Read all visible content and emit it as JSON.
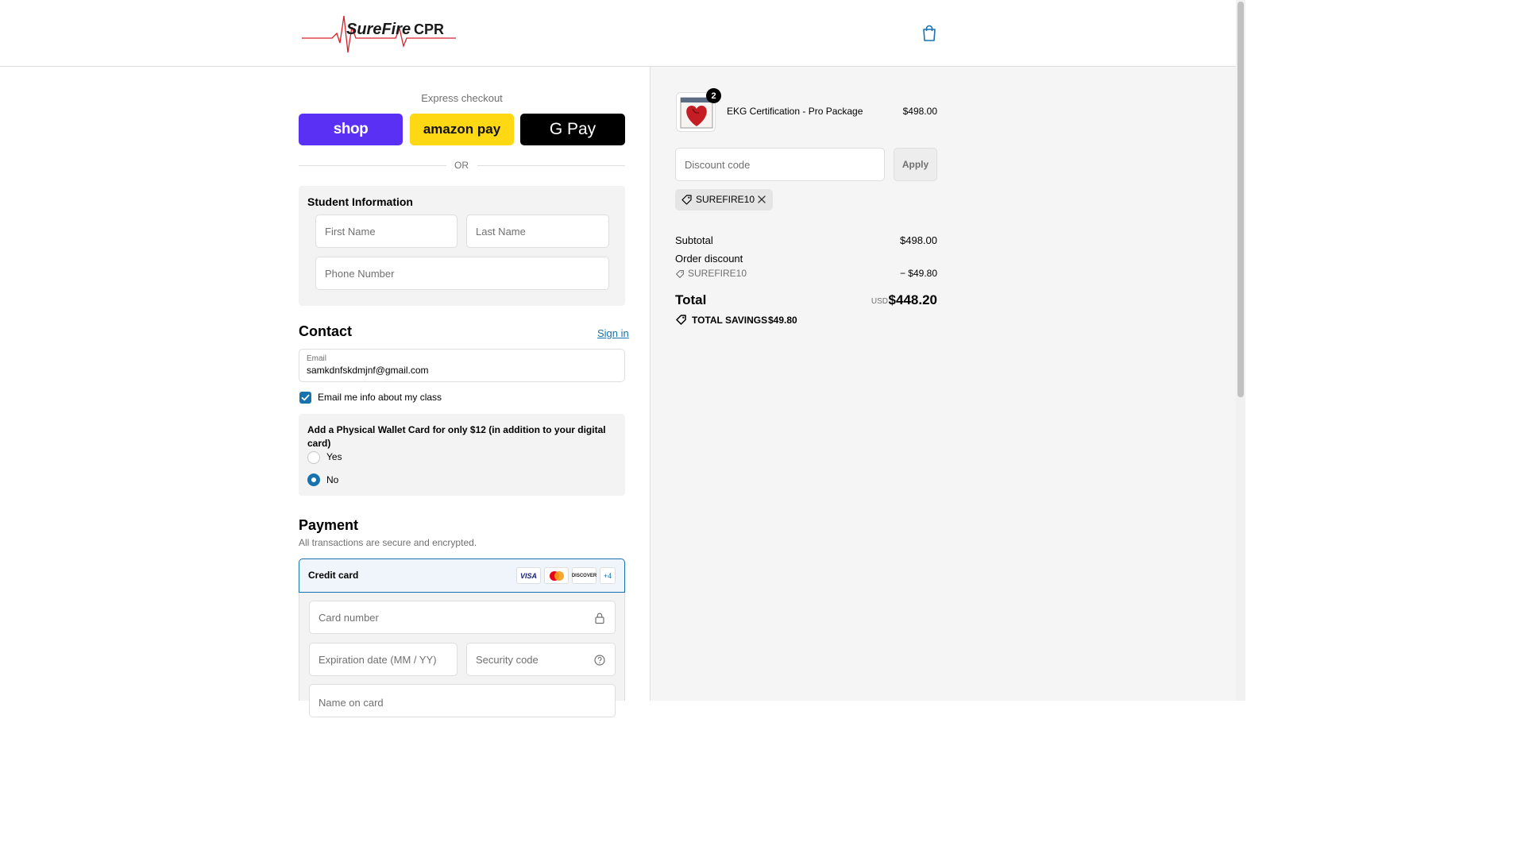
{
  "header": {
    "logo_text": "SureFire CPR",
    "cart_icon": "shopping-bag-icon"
  },
  "express": {
    "title": "Express checkout",
    "shop_label": "shop",
    "amazon_label": "amazon pay",
    "gpay_label": "G Pay",
    "or_label": "OR"
  },
  "student_info": {
    "title": "Student Information",
    "first_name_placeholder": "First Name",
    "last_name_placeholder": "Last Name",
    "phone_placeholder": "Phone Number"
  },
  "contact": {
    "title": "Contact",
    "sign_in": "Sign in",
    "email_label": "Email",
    "email_value": "samkdnfskdmjnf@gmail.com",
    "opt_in_label": "Email me info about my class",
    "opt_in_checked": true
  },
  "wallet_card": {
    "question": "Add a Physical Wallet Card for only $12 (in addition to your digital card)",
    "options": [
      {
        "label": "Yes",
        "selected": false
      },
      {
        "label": "No",
        "selected": true
      }
    ]
  },
  "payment": {
    "title": "Payment",
    "subtitle": "All transactions are secure and encrypted.",
    "method_label": "Credit card",
    "brands": [
      "VISA",
      "Mastercard",
      "DISCOVER",
      "+4"
    ],
    "card_number_placeholder": "Card number",
    "expiry_placeholder": "Expiration date (MM / YY)",
    "security_placeholder": "Security code",
    "name_placeholder": "Name on card"
  },
  "summary": {
    "item": {
      "name": "EKG Certification - Pro Package",
      "quantity": "2",
      "price": "$498.00"
    },
    "discount_placeholder": "Discount code",
    "apply_label": "Apply",
    "applied_code": "SUREFIRE10",
    "subtotal_label": "Subtotal",
    "subtotal_value": "$498.00",
    "order_discount_label": "Order discount",
    "discount_code_label": "SUREFIRE10",
    "discount_value": "− $49.80",
    "total_label": "Total",
    "currency": "USD",
    "total_value": "$448.20",
    "savings_label": "TOTAL SAVINGS",
    "savings_value": "$49.80"
  },
  "colors": {
    "accent": "#1773b0",
    "shop": "#5a31f4",
    "amazon": "#ffd814",
    "gpay": "#000000",
    "logo_red": "#d6232a"
  }
}
